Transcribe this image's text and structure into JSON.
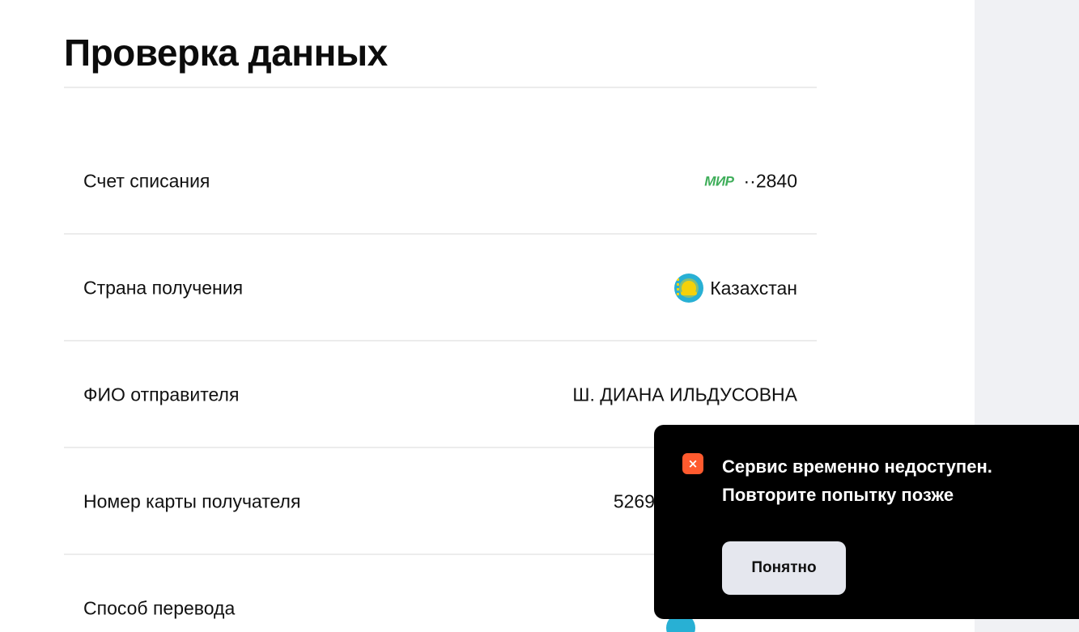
{
  "page": {
    "title": "Проверка данных"
  },
  "details": {
    "debit_account": {
      "label": "Счет списания",
      "card_brand": "МИР",
      "value": "··2840"
    },
    "receiving_country": {
      "label": "Страна получения",
      "flag_icon": "kazakhstan-flag-icon",
      "value": "Казахстан"
    },
    "sender_name": {
      "label": "ФИО отправителя",
      "value": "Ш. ДИАНА ИЛЬДУСОВНА"
    },
    "recipient_card": {
      "label": "Номер карты получателя",
      "value": "5269"
    },
    "transfer_method": {
      "label": "Способ перевода"
    }
  },
  "toast": {
    "icon": "error-close-icon",
    "icon_glyph": "×",
    "message": "Сервис временно недоступен. Повторите попытку позже",
    "button_label": "Понятно",
    "accent_color": "#ff5a2e"
  },
  "colors": {
    "mir_brand": "#3fae5a",
    "side_panel": "#f0f1f4",
    "toast_background": "#000000"
  }
}
